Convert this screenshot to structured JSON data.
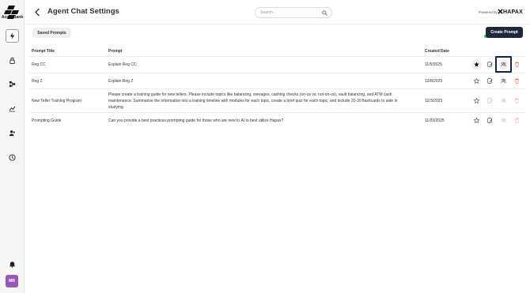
{
  "sidebar": {
    "logo_text": "Acme Bank",
    "avatar_initials": "MR",
    "items": [
      {
        "icon": "lightning-icon",
        "active": true
      },
      {
        "icon": "lock-icon",
        "active": false
      },
      {
        "icon": "workflow-icon",
        "active": false
      },
      {
        "icon": "chart-icon",
        "active": false
      },
      {
        "icon": "users-icon",
        "active": false
      },
      {
        "icon": "history-icon",
        "active": false
      },
      {
        "icon": "bell-icon",
        "active": false
      }
    ]
  },
  "header": {
    "title": "Agent Chat Settings",
    "search_placeholder": "Search...",
    "powered_by": "Powered by",
    "brand": "HAPAX"
  },
  "toolbar": {
    "saved_prompts_label": "Saved Prompts",
    "create_prompt_label": "Create Prompt"
  },
  "table": {
    "columns": [
      "Prompt Title",
      "Prompt",
      "Created Date"
    ],
    "rows": [
      {
        "title": "Reg CC",
        "prompt": "Explain Reg CC",
        "date": "11/5/2025",
        "starred": true
      },
      {
        "title": "Reg Z",
        "prompt": "Explain Reg Z",
        "date": "12/8/2025",
        "starred": false
      },
      {
        "title": "New Teller Training Program",
        "prompt": "Please create a training guide for new tellers. Please include topics like balancing, overages, cashing checks (on-us vs. not-on-us), vault balancing, and ATM cash maintenance. Summarize the information into a training timeline with modules for each topic, create a brief quiz for each topic, and include 20-30 flashcards to aide in studying.",
        "date": "12/3/2025",
        "starred": false
      },
      {
        "title": "Prompting Guide",
        "prompt": "Can you provide a best practices prompting guide for those who are new to AI to best utilize Hapax?",
        "date": "11/20/2025",
        "starred": false
      }
    ]
  },
  "colors": {
    "primary_button": "#1e2a3a",
    "delete": "#e74c3c",
    "avatar": "#9b59b6",
    "highlight": "#0f2458"
  }
}
